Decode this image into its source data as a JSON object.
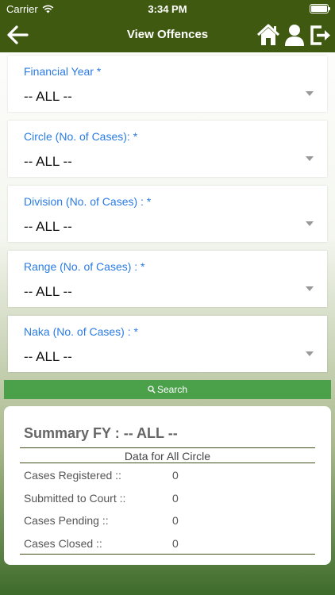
{
  "status_bar": {
    "carrier": "Carrier",
    "time": "3:34 PM"
  },
  "nav": {
    "title": "View Offences",
    "icons": [
      "back-arrow-icon",
      "home-icon",
      "user-icon",
      "logout-icon"
    ]
  },
  "fields": [
    {
      "label": "Financial Year *",
      "value": "-- ALL --"
    },
    {
      "label": "Circle (No. of Cases): *",
      "value": "-- ALL --"
    },
    {
      "label": "Division (No. of Cases) : *",
      "value": "-- ALL --"
    },
    {
      "label": "Range (No. of Cases) : *",
      "value": "-- ALL --"
    },
    {
      "label": "Naka (No. of Cases) : *",
      "value": "-- ALL --"
    }
  ],
  "search_label": "Search",
  "summary": {
    "title": "Summary FY : -- ALL --",
    "caption": "Data for All Circle",
    "rows": [
      {
        "label": "Cases Registered ::",
        "value": "0"
      },
      {
        "label": "Submitted to Court ::",
        "value": "0"
      },
      {
        "label": "Cases Pending ::",
        "value": "0"
      },
      {
        "label": "Cases Closed ::",
        "value": "0"
      }
    ]
  },
  "colors": {
    "header": "#3f5a10",
    "field_label": "#2a7be4",
    "search_button": "#4aa14a"
  }
}
